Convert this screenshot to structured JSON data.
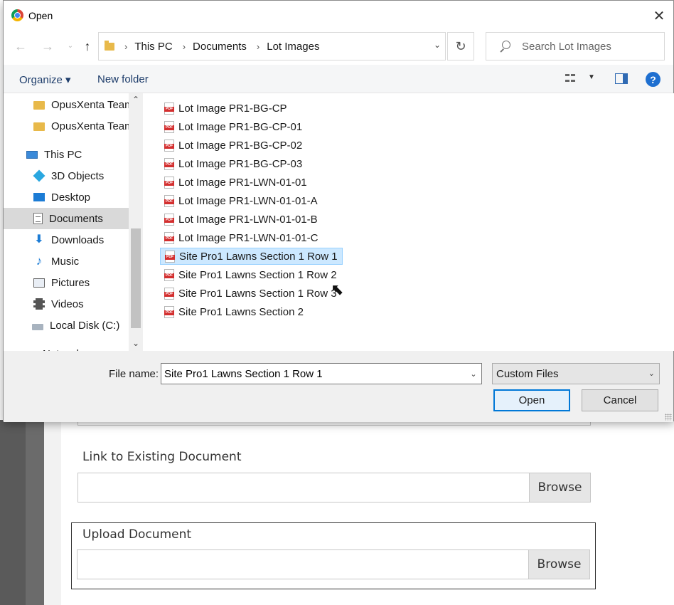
{
  "dialog": {
    "title": "Open",
    "breadcrumb": [
      "This PC",
      "Documents",
      "Lot Images"
    ],
    "search_placeholder": "Search Lot Images",
    "toolbar": {
      "organize": "Organize ▾",
      "new_folder": "New folder",
      "help": "?"
    },
    "nav_items": [
      {
        "label": "OpusXenta Team",
        "icon": "folder-icon"
      },
      {
        "label": "OpusXenta Team",
        "icon": "folder-icon"
      },
      {
        "label": "This PC",
        "icon": "pc-icon"
      },
      {
        "label": "3D Objects",
        "icon": "3d-objects-icon"
      },
      {
        "label": "Desktop",
        "icon": "desktop-icon"
      },
      {
        "label": "Documents",
        "icon": "documents-icon",
        "selected": true
      },
      {
        "label": "Downloads",
        "icon": "downloads-icon"
      },
      {
        "label": "Music",
        "icon": "music-icon"
      },
      {
        "label": "Pictures",
        "icon": "pictures-icon"
      },
      {
        "label": "Videos",
        "icon": "videos-icon"
      },
      {
        "label": "Local Disk (C:)",
        "icon": "disk-icon"
      },
      {
        "label": "Network",
        "icon": "network-icon"
      }
    ],
    "files": [
      "Lot Image PR1-BG-CP",
      "Lot Image PR1-BG-CP-01",
      "Lot Image PR1-BG-CP-02",
      "Lot Image PR1-BG-CP-03",
      "Lot Image PR1-LWN-01-01",
      "Lot Image PR1-LWN-01-01-A",
      "Lot Image PR1-LWN-01-01-B",
      "Lot Image PR1-LWN-01-01-C",
      "Site Pro1 Lawns Section 1 Row 1",
      "Site Pro1 Lawns Section 1 Row 2",
      "Site Pro1 Lawns Section 1 Row 3",
      "Site Pro1 Lawns Section 2"
    ],
    "selected_file": "Site Pro1 Lawns Section 1 Row 1",
    "file_name_label": "File name:",
    "file_name_value": "Site Pro1 Lawns Section 1 Row 1",
    "file_type": "Custom Files",
    "open_label": "Open",
    "cancel_label": "Cancel"
  },
  "page": {
    "link_label": "Link to Existing Document",
    "link_browse": "Browse",
    "upload_label": "Upload Document",
    "upload_browse": "Browse"
  },
  "colors": {
    "accent": "#0078d7",
    "selection": "#cce8ff",
    "help": "#1e6fd0"
  }
}
